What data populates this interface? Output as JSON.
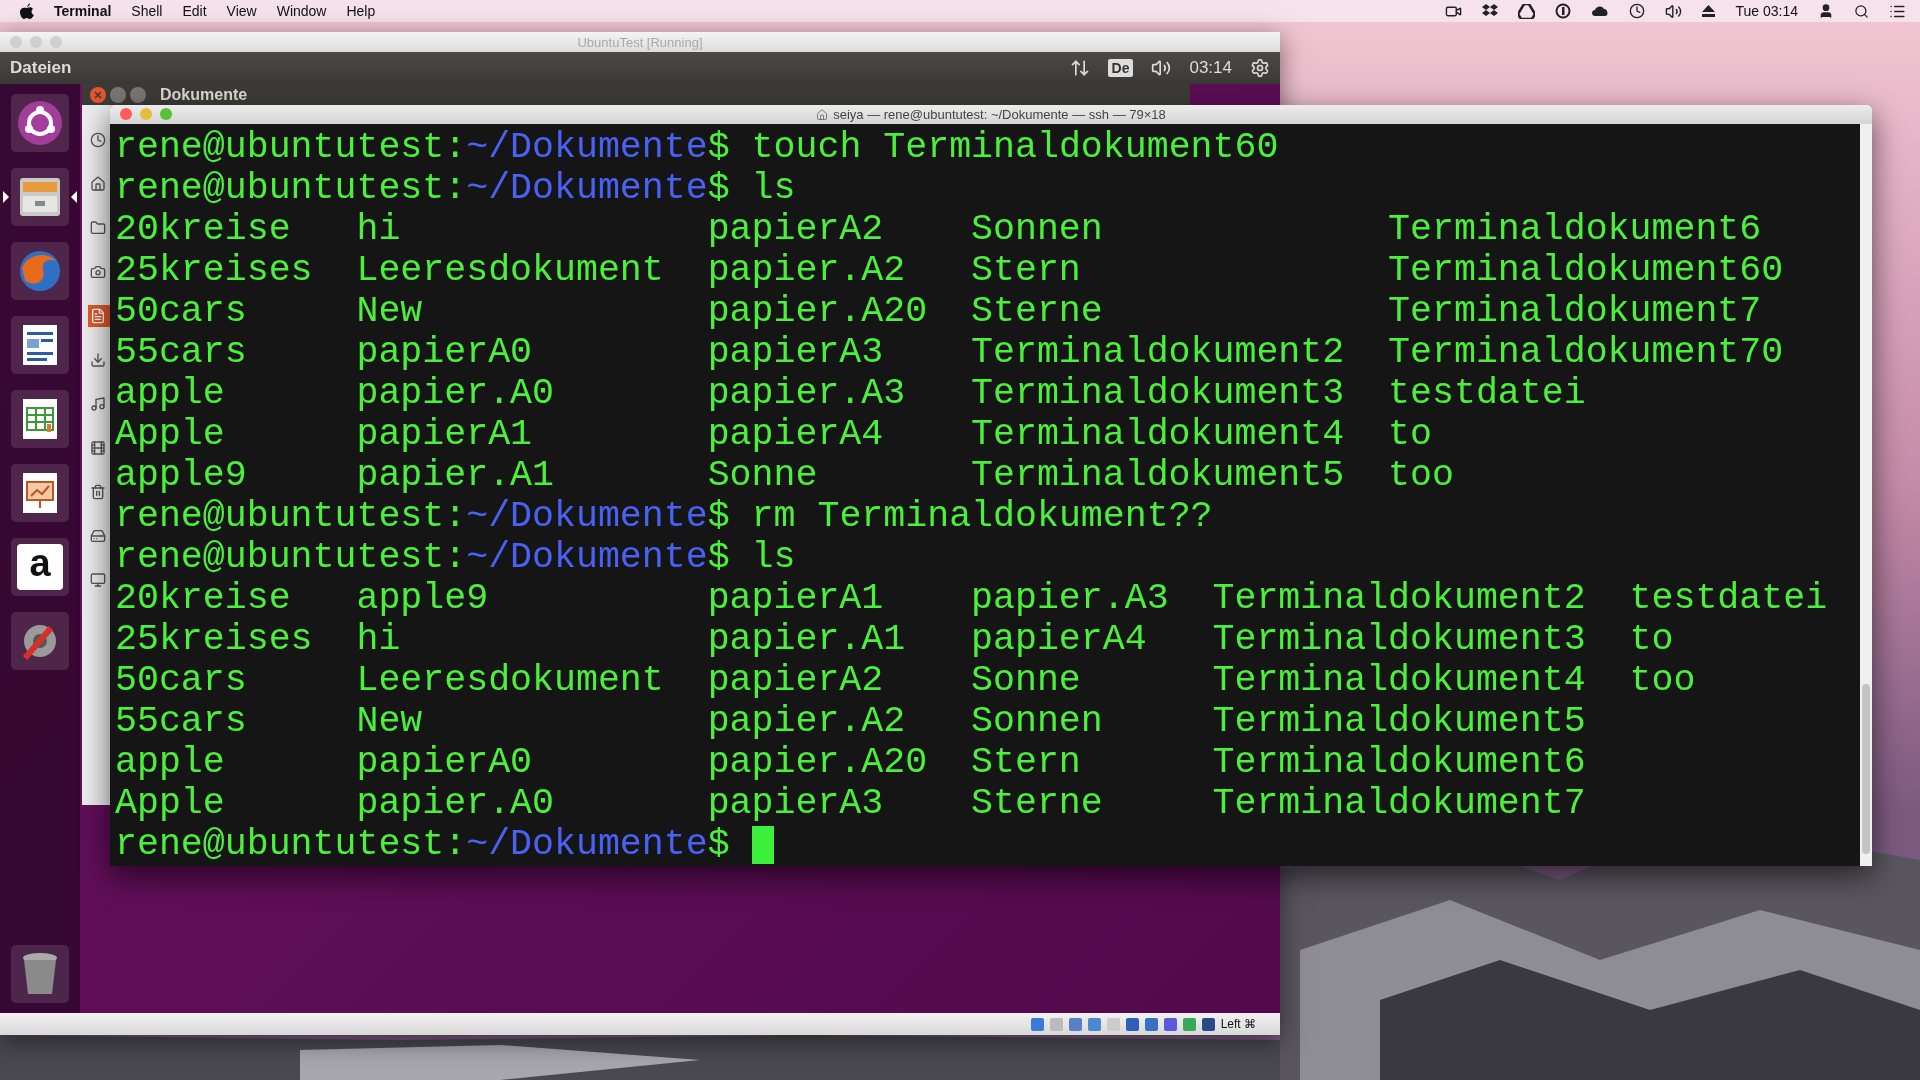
{
  "menubar": {
    "app_name": "Terminal",
    "menus": [
      "Shell",
      "Edit",
      "View",
      "Window",
      "Help"
    ],
    "clock": "Tue 03:14"
  },
  "vm_window": {
    "title": "UbuntuTest [Running]",
    "panel": {
      "app_title": "Dateien",
      "keyboard": "De",
      "clock": "03:14"
    },
    "launcher": [
      {
        "kind": "dash",
        "running": false
      },
      {
        "kind": "files",
        "running": true
      },
      {
        "kind": "browser",
        "running": false
      },
      {
        "kind": "writer",
        "running": false
      },
      {
        "kind": "calc",
        "running": false
      },
      {
        "kind": "impress",
        "running": false
      },
      {
        "kind": "store",
        "running": false,
        "glyph": "a"
      },
      {
        "kind": "settings",
        "running": false
      },
      {
        "kind": "trash",
        "running": false
      }
    ],
    "file_window": {
      "title": "Dokumente"
    },
    "status_bar": {
      "host_key": "Left ⌘"
    }
  },
  "terminal": {
    "title": "seiya — rene@ubuntutest: ~/Dokumente — ssh — 79×18",
    "blocks": [
      {
        "kind": "prompt",
        "user_host": "rene@ubuntutest:",
        "path": "~/Dokumente",
        "sign": "$",
        "command": "touch Terminaldokument60",
        "cursor": false
      },
      {
        "kind": "prompt",
        "user_host": "rene@ubuntutest:",
        "path": "~/Dokumente",
        "sign": "$",
        "command": "ls",
        "cursor": false
      },
      {
        "kind": "listing",
        "rows": [
          [
            "20kreise",
            "hi",
            "papierA2",
            "Sonnen",
            "Terminaldokument6"
          ],
          [
            "25kreises",
            "Leeresdokument",
            "papier.A2",
            "Stern",
            "Terminaldokument60"
          ],
          [
            "50cars",
            "New",
            "papier.A20",
            "Sterne",
            "Terminaldokument7"
          ],
          [
            "55cars",
            "papierA0",
            "papierA3",
            "Terminaldokument2",
            "Terminaldokument70"
          ],
          [
            "apple",
            "papier.A0",
            "papier.A3",
            "Terminaldokument3",
            "testdatei"
          ],
          [
            "Apple",
            "papierA1",
            "papierA4",
            "Terminaldokument4",
            "to"
          ],
          [
            "apple9",
            "papier.A1",
            "Sonne",
            "Terminaldokument5",
            "too"
          ]
        ]
      },
      {
        "kind": "prompt",
        "user_host": "rene@ubuntutest:",
        "path": "~/Dokumente",
        "sign": "$",
        "command": "rm Terminaldokument??",
        "cursor": false
      },
      {
        "kind": "prompt",
        "user_host": "rene@ubuntutest:",
        "path": "~/Dokumente",
        "sign": "$",
        "command": "ls",
        "cursor": false
      },
      {
        "kind": "listing",
        "rows": [
          [
            "20kreise",
            "apple9",
            "papierA1",
            "papier.A3",
            "Terminaldokument2",
            "testdatei"
          ],
          [
            "25kreises",
            "hi",
            "papier.A1",
            "papierA4",
            "Terminaldokument3",
            "to"
          ],
          [
            "50cars",
            "Leeresdokument",
            "papierA2",
            "Sonne",
            "Terminaldokument4",
            "too"
          ],
          [
            "55cars",
            "New",
            "papier.A2",
            "Sonnen",
            "Terminaldokument5"
          ],
          [
            "apple",
            "papierA0",
            "papier.A20",
            "Stern",
            "Terminaldokument6"
          ],
          [
            "Apple",
            "papier.A0",
            "papierA3",
            "Sterne",
            "Terminaldokument7"
          ]
        ]
      },
      {
        "kind": "prompt",
        "user_host": "rene@ubuntutest:",
        "path": "~/Dokumente",
        "sign": "$",
        "cursor": true
      }
    ]
  }
}
